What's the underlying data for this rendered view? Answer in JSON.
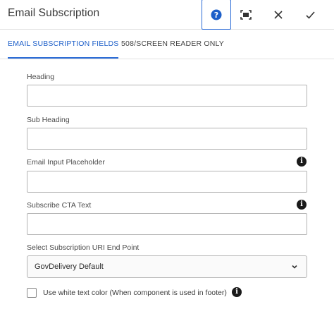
{
  "dialog": {
    "title": "Email Subscription"
  },
  "header_buttons": {
    "help": "help-icon",
    "fullscreen": "fullscreen-icon",
    "close": "close-icon",
    "done": "checkmark-icon"
  },
  "tabs": [
    {
      "label": "EMAIL SUBSCRIPTION FIELDS",
      "active": true
    },
    {
      "label": "508/SCREEN READER ONLY",
      "active": false
    }
  ],
  "fields": {
    "heading": {
      "label": "Heading",
      "value": ""
    },
    "sub_heading": {
      "label": "Sub Heading",
      "value": ""
    },
    "email_placeholder": {
      "label": "Email Input Placeholder",
      "value": "",
      "info_icon": "info-icon"
    },
    "subscribe_cta": {
      "label": "Subscribe CTA Text",
      "value": "",
      "info_icon": "info-icon"
    },
    "uri_endpoint": {
      "label": "Select Subscription URI End Point",
      "selected": "GovDelivery Default"
    }
  },
  "checkbox": {
    "label": "Use white text color (When component is used in footer)",
    "checked": false
  },
  "colors": {
    "accent": "#2b6bd6",
    "help_icon": "#1d5fc9",
    "border": "#b3b3b3"
  }
}
